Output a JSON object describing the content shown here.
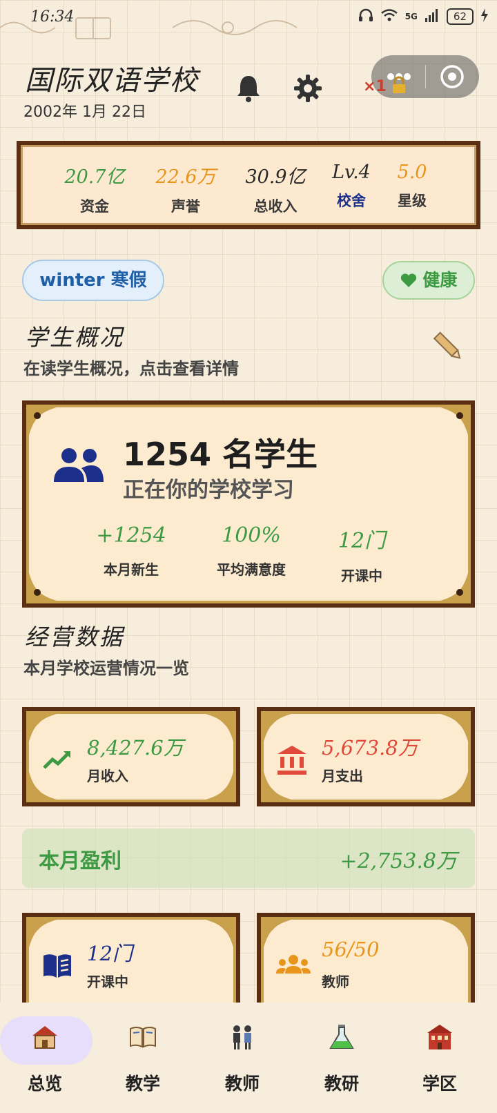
{
  "status_bar": {
    "time": "16:34",
    "signal": "5G",
    "battery": "62"
  },
  "header": {
    "school_name": "国际双语学校",
    "date": "2002年 1月 22日",
    "badge": "×1"
  },
  "stats": [
    {
      "value": "20.7亿",
      "label": "资金",
      "value_color": "#3d9a43",
      "label_color": "#3a3a3a"
    },
    {
      "value": "22.6万",
      "label": "声誉",
      "value_color": "#e8951c",
      "label_color": "#3a3a3a"
    },
    {
      "value": "30.9亿",
      "label": "总收入",
      "value_color": "#2a2a2a",
      "label_color": "#3a3a3a"
    },
    {
      "value": "Lv.4",
      "label": "校舍",
      "value_color": "#2a2a2a",
      "label_color": "#1c2f8a"
    },
    {
      "value": "5.0",
      "label": "星级",
      "value_color": "#e8951c",
      "label_color": "#3a3a3a"
    }
  ],
  "season": "winter 寒假",
  "health": "健康",
  "students": {
    "title": "学生概况",
    "subtitle": "在读学生概况，点击查看详情",
    "count": "1254 名学生",
    "caption": "正在你的学校学习",
    "metrics": [
      {
        "value": "+1254",
        "label": "本月新生"
      },
      {
        "value": "100%",
        "label": "平均满意度"
      },
      {
        "value": "12门",
        "label": "开课中"
      }
    ]
  },
  "operations": {
    "title": "经营数据",
    "subtitle": "本月学校运营情况一览",
    "income": {
      "value": "8,427.6万",
      "label": "月收入",
      "color": "#3d9a43"
    },
    "expense": {
      "value": "5,673.8万",
      "label": "月支出",
      "color": "#e04a3a"
    },
    "profit": {
      "label": "本月盈利",
      "value": "+2,753.8万"
    },
    "courses": {
      "value": "12门",
      "label": "开课中",
      "color": "#1c2f8a"
    },
    "teachers": {
      "value": "56/50",
      "label": "教师",
      "color": "#e8951c"
    }
  },
  "nav": [
    {
      "label": "总览",
      "icon": "school-house-icon",
      "active": true
    },
    {
      "label": "教学",
      "icon": "book-icon",
      "active": false
    },
    {
      "label": "教师",
      "icon": "teachers-icon",
      "active": false
    },
    {
      "label": "教研",
      "icon": "flask-icon",
      "active": false
    },
    {
      "label": "学区",
      "icon": "campus-building-icon",
      "active": false
    }
  ]
}
